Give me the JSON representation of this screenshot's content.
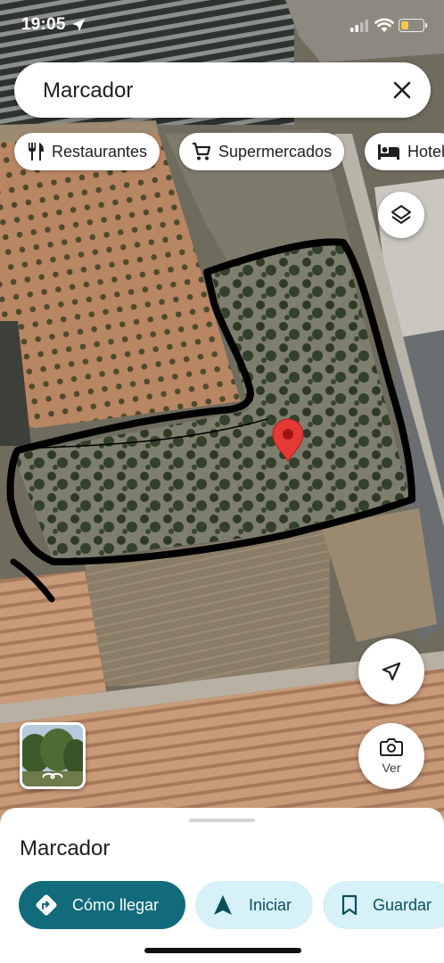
{
  "status_bar": {
    "time": "19:05",
    "battery_level": 0.35,
    "battery_color": "#f2c94c"
  },
  "search": {
    "value": "Marcador"
  },
  "chips": [
    {
      "label": "Restaurantes",
      "icon": "fork-knife-icon"
    },
    {
      "label": "Supermercados",
      "icon": "shopping-cart-icon"
    },
    {
      "label": "Hotel",
      "icon": "bed-icon"
    }
  ],
  "map": {
    "marker_color": "#e53935",
    "outline_color": "#000000"
  },
  "view_button": {
    "label": "Ver"
  },
  "sheet": {
    "title": "Marcador",
    "actions": {
      "directions": "Cómo llegar",
      "start": "Iniciar",
      "save": "Guardar"
    }
  },
  "colors": {
    "primary_action": "#116b7a",
    "secondary_action": "#d6f1f7"
  }
}
